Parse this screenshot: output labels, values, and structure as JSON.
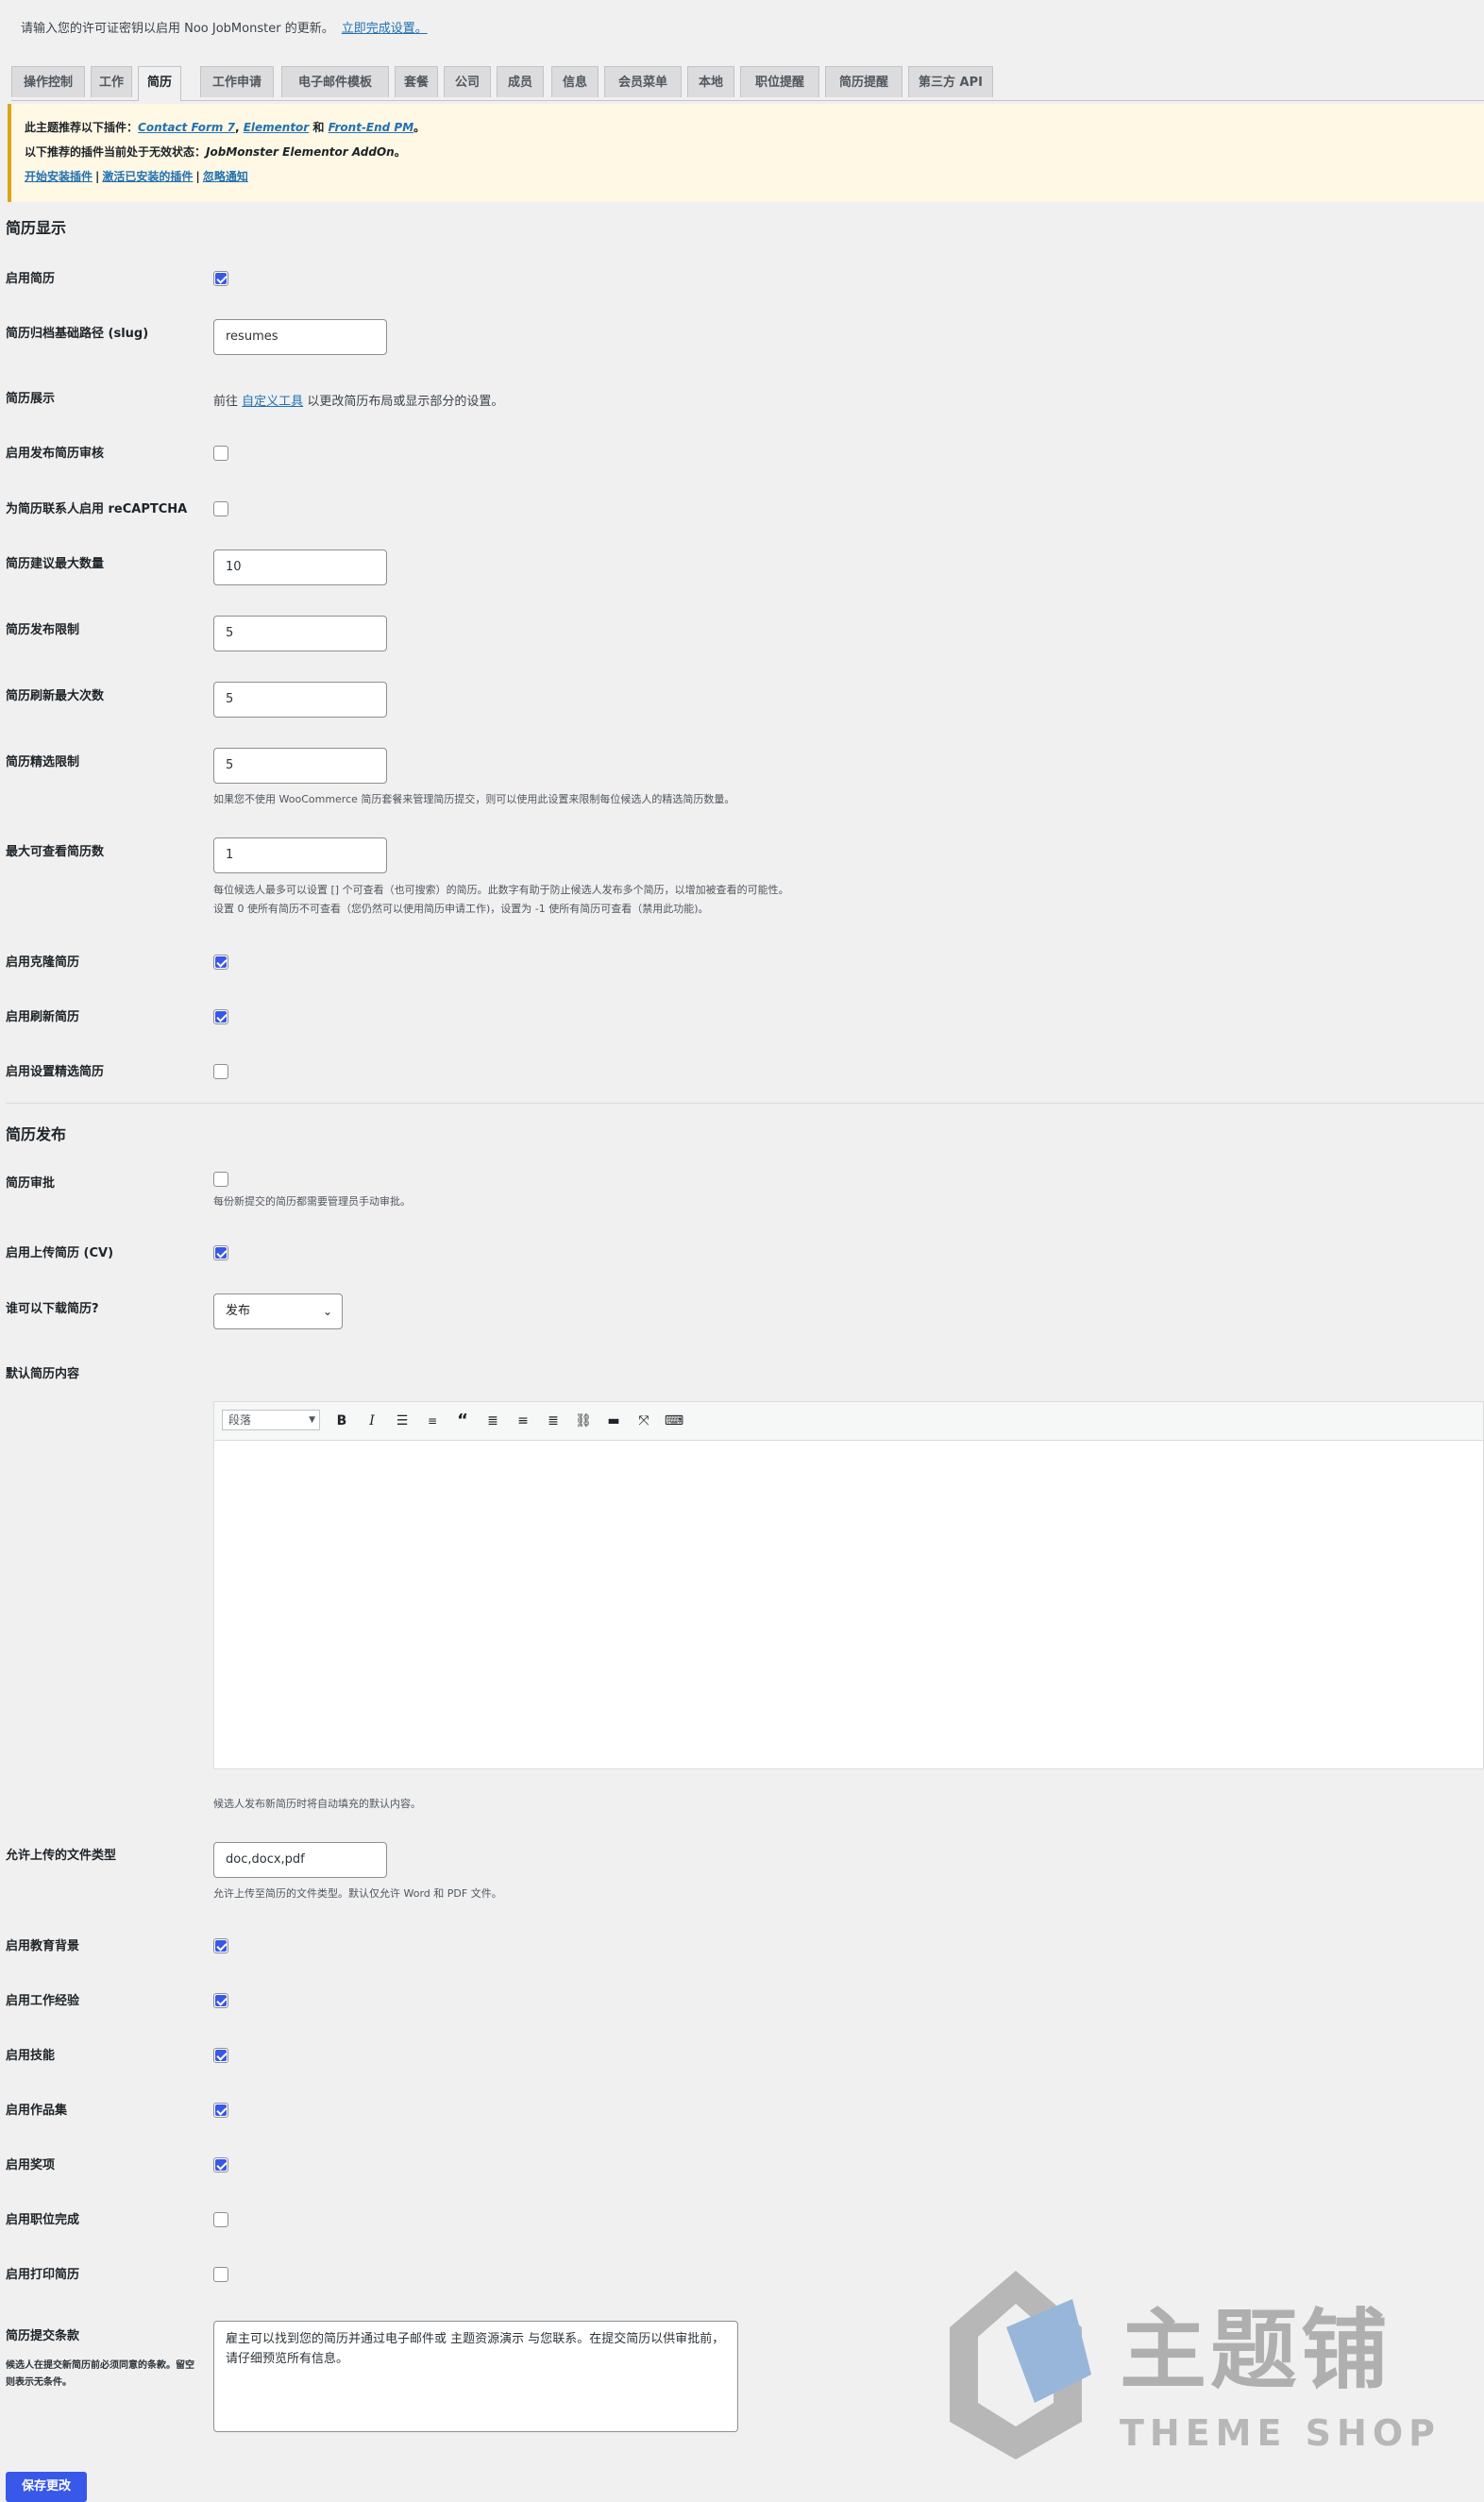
{
  "license": {
    "text": "请输入您的许可证密钥以启用 Noo JobMonster 的更新。",
    "link": "立即完成设置。"
  },
  "tabs": [
    {
      "label": "操作控制"
    },
    {
      "label": "工作"
    },
    {
      "label": "简历"
    },
    {
      "label": "工作申请"
    },
    {
      "label": "电子邮件模板"
    },
    {
      "label": "套餐"
    },
    {
      "label": "公司"
    },
    {
      "label": "成员"
    },
    {
      "label": "信息"
    },
    {
      "label": "会员菜单"
    },
    {
      "label": "本地"
    },
    {
      "label": "职位提醒"
    },
    {
      "label": "简历提醒"
    },
    {
      "label": "第三方 API"
    }
  ],
  "active_tab": "简历",
  "notice": {
    "line1_prefix": "此主题推荐以下插件：",
    "plugin1": "Contact Form 7",
    "comma": ",",
    "plugin2": "Elementor",
    "and": "和",
    "plugin3": "Front-End PM",
    "period": "。",
    "line2_prefix": "以下推荐的插件当前处于无效状态：",
    "inactive_plugin": "JobMonster Elementor AddOn",
    "link1": "开始安装插件",
    "link2": "激活已安装的插件",
    "link3": "忽略通知",
    "separator": "|"
  },
  "section_display": {
    "title": "简历显示"
  },
  "display": {
    "enable_resume": {
      "label": "启用简历",
      "checked": true
    },
    "slug": {
      "label": "简历归档基础路径 (slug)",
      "value": "resumes"
    },
    "showcase": {
      "label": "简历展示",
      "prefix": "前往",
      "link": "自定义工具",
      "suffix": "以更改简历布局或显示部分的设置。"
    },
    "review": {
      "label": "启用发布简历审核",
      "checked": false
    },
    "recaptcha": {
      "label": "为简历联系人启用 reCAPTCHA",
      "checked": false
    },
    "max_suggest": {
      "label": "简历建议最大数量",
      "value": "10"
    },
    "post_limit": {
      "label": "简历发布限制",
      "value": "5"
    },
    "refresh_max": {
      "label": "简历刷新最大次数",
      "value": "5"
    },
    "featured_limit": {
      "label": "简历精选限制",
      "value": "5",
      "desc": "如果您不使用 WooCommerce 简历套餐来管理简历提交，则可以使用此设置来限制每位候选人的精选简历数量。"
    },
    "max_viewable": {
      "label": "最大可查看简历数",
      "value": "1",
      "desc1": "每位候选人最多可以设置 [] 个可查看（也可搜索）的简历。此数字有助于防止候选人发布多个简历，以增加被查看的可能性。",
      "desc2": "设置 0 使所有简历不可查看（您仍然可以使用简历申请工作)，设置为 -1 使所有简历可查看（禁用此功能)。"
    },
    "clone": {
      "label": "启用克隆简历",
      "checked": true
    },
    "refresh": {
      "label": "启用刷新简历",
      "checked": true
    },
    "set_featured": {
      "label": "启用设置精选简历",
      "checked": false
    }
  },
  "section_posting": {
    "title": "简历发布"
  },
  "posting": {
    "approval": {
      "label": "简历审批",
      "checked": false,
      "desc": "每份新提交的简历都需要管理员手动审批。"
    },
    "upload_cv": {
      "label": "启用上传简历 (CV)",
      "checked": true
    },
    "who_download": {
      "label": "谁可以下载简历?",
      "value": "发布"
    },
    "default_content": {
      "label": "默认简历内容",
      "format": "段落",
      "desc": "候选人发布新简历时将自动填充的默认内容。"
    },
    "file_types": {
      "label": "允许上传的文件类型",
      "value": "doc,docx,pdf",
      "desc": "允许上传至简历的文件类型。默认仅允许 Word 和 PDF 文件。"
    },
    "education": {
      "label": "启用教育背景",
      "checked": true
    },
    "experience": {
      "label": "启用工作经验",
      "checked": true
    },
    "skills": {
      "label": "启用技能",
      "checked": true
    },
    "portfolio": {
      "label": "启用作品集",
      "checked": true
    },
    "awards": {
      "label": "启用奖项",
      "checked": true
    },
    "job_complete": {
      "label": "启用职位完成",
      "checked": false
    },
    "print": {
      "label": "启用打印简历",
      "checked": false
    },
    "terms": {
      "label": "简历提交条款",
      "sublabel": "候选人在提交新简历前必须同意的条款。留空则表示无条件。",
      "value": "雇主可以找到您的简历并通过电子邮件或 主题资源演示 与您联系。在提交简历以供审批前，请仔细预览所有信息。"
    }
  },
  "save_button": "保存更改",
  "watermark": {
    "brand": "主题铺",
    "sub": "THEME SHOP"
  },
  "colors": {
    "accent": "#3858e9",
    "link": "#2271b1",
    "notice_border": "#dba617"
  }
}
